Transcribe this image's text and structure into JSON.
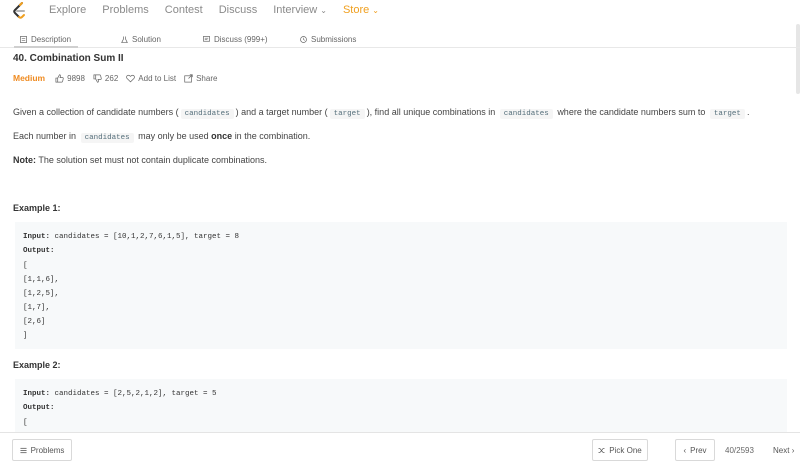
{
  "nav": {
    "items": [
      "Explore",
      "Problems",
      "Contest",
      "Discuss"
    ],
    "interview": "Interview",
    "store": "Store",
    "accent_color": "#f0a020"
  },
  "tabs": [
    {
      "label": "Description",
      "icon": "document-icon"
    },
    {
      "label": "Solution",
      "icon": "flask-icon"
    },
    {
      "label": "Discuss (999+)",
      "icon": "discuss-icon"
    },
    {
      "label": "Submissions",
      "icon": "clock-icon"
    }
  ],
  "problem": {
    "title": "40. Combination Sum II",
    "difficulty": "Medium",
    "difficulty_color": "#ef8a1f",
    "likes": "9898",
    "dislikes": "262",
    "add_to_list": "Add to List",
    "share": "Share"
  },
  "description": {
    "p1": {
      "t1": "Given a collection of candidate numbers (",
      "c1": "candidates",
      "t2": ") and a target number (",
      "c2": "target",
      "t3": "), find all unique combinations in",
      "c3": "candidates",
      "t4": "where the candidate numbers sum to",
      "c4": "target",
      "t5": "."
    },
    "p2": {
      "t1": "Each number in",
      "c1": "candidates",
      "t2": "may only be used",
      "b1": "once",
      "t3": "in the combination."
    },
    "note": {
      "label": "Note:",
      "text": "The solution set must not contain duplicate combinations."
    }
  },
  "examples": [
    {
      "title": "Example 1:",
      "input_label": "Input:",
      "input": "candidates = [10,1,2,7,6,1,5], target = 8",
      "output_label": "Output:",
      "output_lines": [
        "[",
        "[1,1,6],",
        "[1,2,5],",
        "[1,7],",
        "[2,6]",
        "]"
      ]
    },
    {
      "title": "Example 2:",
      "input_label": "Input:",
      "input": "candidates = [2,5,2,1,2], target = 5",
      "output_label": "Output:",
      "output_lines": [
        "["
      ]
    }
  ],
  "bottom": {
    "problems": "Problems",
    "pick_one": "Pick One",
    "prev": "Prev",
    "pager": "40/2593",
    "next": "Next"
  }
}
